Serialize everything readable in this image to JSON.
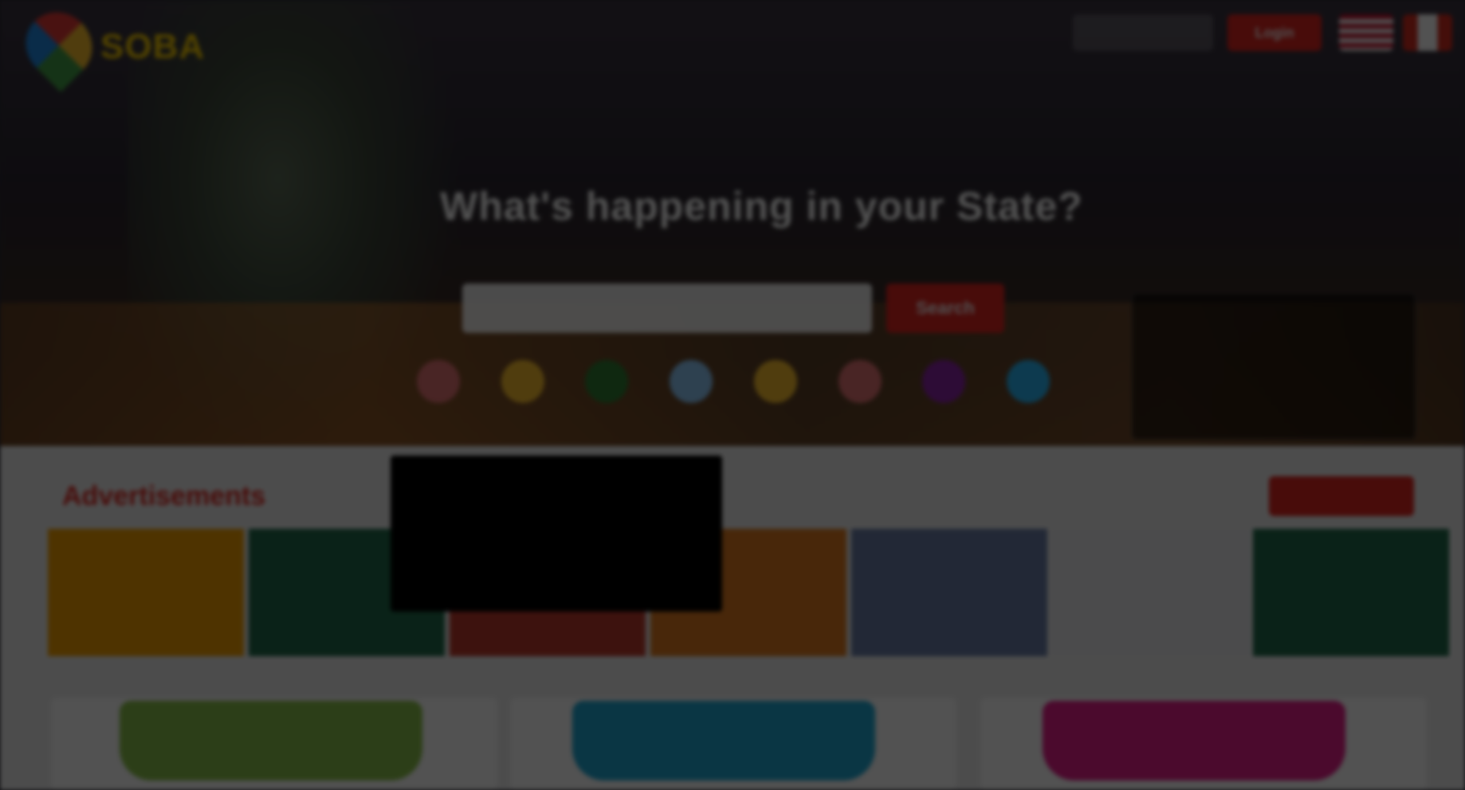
{
  "header": {
    "logo_text": "SOBA",
    "logo_tagline": "",
    "search_label": "",
    "login_label": "Login",
    "nav": [
      "",
      "",
      "",
      ""
    ]
  },
  "hero": {
    "kicker": "",
    "headline": "What's happening in your State?",
    "sub": "",
    "search_placeholder": "",
    "search_button": "Search"
  },
  "categories": [
    {
      "label": "",
      "color": "#e57373"
    },
    {
      "label": "",
      "color": "#fbc02d"
    },
    {
      "label": "",
      "color": "#2e7d32"
    },
    {
      "label": "",
      "color": "#90caf9"
    },
    {
      "label": "",
      "color": "#fbc02d"
    },
    {
      "label": "",
      "color": "#e57373"
    },
    {
      "label": "",
      "color": "#8e24aa"
    },
    {
      "label": "",
      "color": "#29b6f6"
    }
  ],
  "notification": {
    "title": "",
    "body": ""
  },
  "advertisements": {
    "title": "Advertisements",
    "view_all": "",
    "items": [
      {
        "color": "#f4a000"
      },
      {
        "color": "#1f6b4a"
      },
      {
        "color": "#c0392b"
      },
      {
        "color": "#e07a1f"
      },
      {
        "color": "#6a7ea8"
      },
      {
        "color": "#e9e9ef"
      },
      {
        "color": "#1f6b4a"
      }
    ]
  },
  "tooltip": {
    "lines": [
      "",
      "",
      "",
      ""
    ]
  },
  "features": [
    {
      "label": "",
      "color": "#8bc34a"
    },
    {
      "label": "",
      "color": "#1fa9d6"
    },
    {
      "label": "",
      "color": "#e91e8c"
    }
  ]
}
